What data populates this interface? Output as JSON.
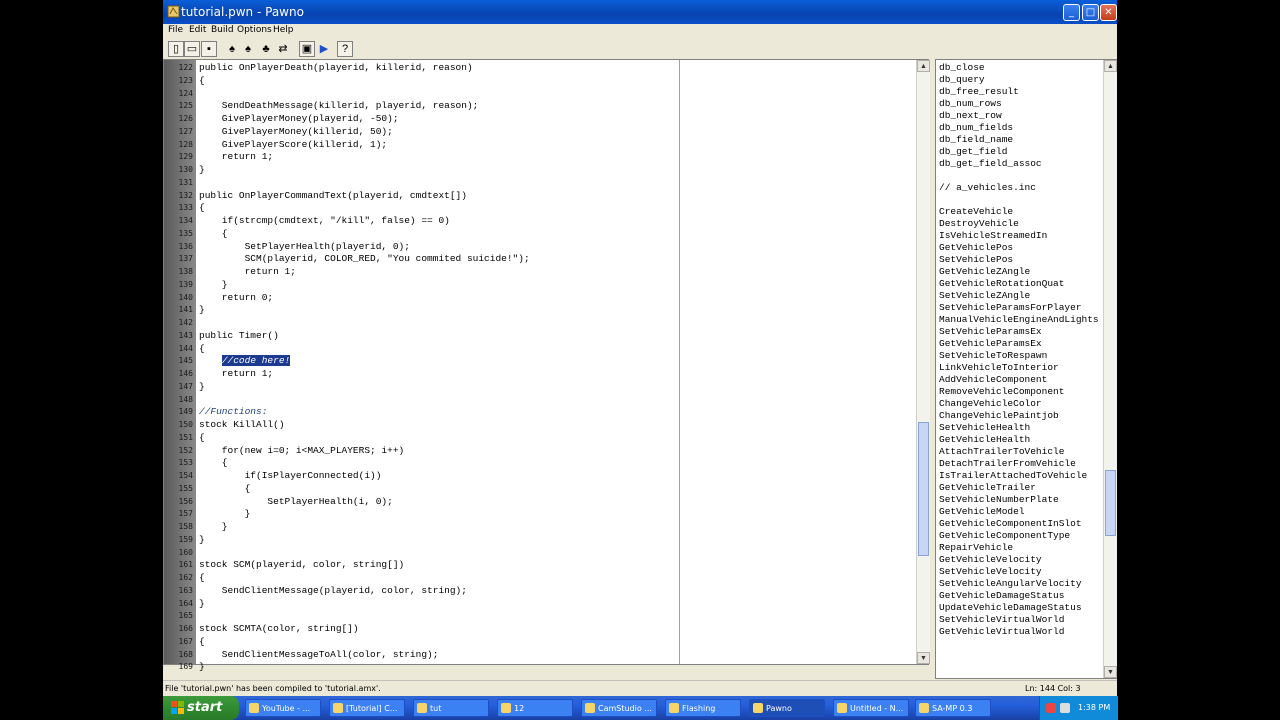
{
  "window": {
    "title": "tutorial.pwn - Pawno"
  },
  "menu": [
    "File",
    "Edit",
    "Build",
    "Options",
    "Help"
  ],
  "toolbar": [
    "new-file-icon",
    "open-folder-icon",
    "save-icon",
    "find-icon",
    "find-next-icon",
    "replace-icon",
    "goto-line-icon",
    "compile-icon",
    "run-icon",
    "help-icon"
  ],
  "editor": {
    "lines": [
      {
        "n": "122",
        "t": "public OnPlayerDeath(playerid, killerid, reason)"
      },
      {
        "n": "123",
        "t": "{"
      },
      {
        "n": "124",
        "t": ""
      },
      {
        "n": "125",
        "t": "    SendDeathMessage(killerid, playerid, reason);"
      },
      {
        "n": "126",
        "t": "    GivePlayerMoney(playerid, -50);"
      },
      {
        "n": "127",
        "t": "    GivePlayerMoney(killerid, 50);"
      },
      {
        "n": "128",
        "t": "    GivePlayerScore(killerid, 1);"
      },
      {
        "n": "129",
        "t": "    return 1;"
      },
      {
        "n": "130",
        "t": "}"
      },
      {
        "n": "131",
        "t": ""
      },
      {
        "n": "132",
        "t": "public OnPlayerCommandText(playerid, cmdtext[])"
      },
      {
        "n": "133",
        "t": "{"
      },
      {
        "n": "134",
        "t": "    if(strcmp(cmdtext, \"/kill\", false) == 0)"
      },
      {
        "n": "135",
        "t": "    {"
      },
      {
        "n": "136",
        "t": "        SetPlayerHealth(playerid, 0);"
      },
      {
        "n": "137",
        "t": "        SCM(playerid, COLOR_RED, \"You commited suicide!\");"
      },
      {
        "n": "138",
        "t": "        return 1;"
      },
      {
        "n": "139",
        "t": "    }"
      },
      {
        "n": "140",
        "t": "    return 0;"
      },
      {
        "n": "141",
        "t": "}"
      },
      {
        "n": "142",
        "t": ""
      },
      {
        "n": "143",
        "t": "public Timer()"
      },
      {
        "n": "144",
        "t": "{"
      },
      {
        "n": "145",
        "t": "    ",
        "sel": "//code here!"
      },
      {
        "n": "146",
        "t": "    return 1;"
      },
      {
        "n": "147",
        "t": "}"
      },
      {
        "n": "148",
        "t": ""
      },
      {
        "n": "149",
        "t": "//Functions:",
        "comment": true
      },
      {
        "n": "150",
        "t": "stock KillAll()"
      },
      {
        "n": "151",
        "t": "{"
      },
      {
        "n": "152",
        "t": "    for(new i=0; i<MAX_PLAYERS; i++)"
      },
      {
        "n": "153",
        "t": "    {"
      },
      {
        "n": "154",
        "t": "        if(IsPlayerConnected(i))"
      },
      {
        "n": "155",
        "t": "        {"
      },
      {
        "n": "156",
        "t": "            SetPlayerHealth(i, 0);"
      },
      {
        "n": "157",
        "t": "        }"
      },
      {
        "n": "158",
        "t": "    }"
      },
      {
        "n": "159",
        "t": "}"
      },
      {
        "n": "160",
        "t": ""
      },
      {
        "n": "161",
        "t": "stock SCM(playerid, color, string[])"
      },
      {
        "n": "162",
        "t": "{"
      },
      {
        "n": "163",
        "t": "    SendClientMessage(playerid, color, string);"
      },
      {
        "n": "164",
        "t": "}"
      },
      {
        "n": "165",
        "t": ""
      },
      {
        "n": "166",
        "t": "stock SCMTA(color, string[])"
      },
      {
        "n": "167",
        "t": "{"
      },
      {
        "n": "168",
        "t": "    SendClientMessageToAll(color, string);"
      },
      {
        "n": "169",
        "t": "}"
      }
    ]
  },
  "functions": [
    "db_close",
    "db_query",
    "db_free_result",
    "db_num_rows",
    "db_next_row",
    "db_num_fields",
    "db_field_name",
    "db_get_field",
    "db_get_field_assoc",
    "",
    " // a_vehicles.inc",
    "",
    "CreateVehicle",
    "DestroyVehicle",
    "IsVehicleStreamedIn",
    "GetVehiclePos",
    "SetVehiclePos",
    "GetVehicleZAngle",
    "GetVehicleRotationQuat",
    "SetVehicleZAngle",
    "SetVehicleParamsForPlayer",
    "ManualVehicleEngineAndLights",
    "SetVehicleParamsEx",
    "GetVehicleParamsEx",
    "SetVehicleToRespawn",
    "LinkVehicleToInterior",
    "AddVehicleComponent",
    "RemoveVehicleComponent",
    "ChangeVehicleColor",
    "ChangeVehiclePaintjob",
    "SetVehicleHealth",
    "GetVehicleHealth",
    "AttachTrailerToVehicle",
    "DetachTrailerFromVehicle",
    "IsTrailerAttachedToVehicle",
    "GetVehicleTrailer",
    "SetVehicleNumberPlate",
    "GetVehicleModel",
    "GetVehicleComponentInSlot",
    "GetVehicleComponentType",
    "RepairVehicle",
    "GetVehicleVelocity",
    "SetVehicleVelocity",
    "SetVehicleAngularVelocity",
    "GetVehicleDamageStatus",
    "UpdateVehicleDamageStatus",
    "SetVehicleVirtualWorld",
    "GetVehicleVirtualWorld"
  ],
  "status": {
    "message": "File 'tutorial.pwn' has been compiled to 'tutorial.amx'.",
    "position": "Ln: 144  Col: 3"
  },
  "taskbar": {
    "start": "start",
    "tasks": [
      "YouTube - ...",
      "[Tutorial] C...",
      "tut",
      "12",
      "CamStudio ...",
      "Flashing",
      "Pawno",
      "Untitled - N...",
      "SA-MP 0.3"
    ],
    "active": "Pawno",
    "clock": "1:38 PM"
  }
}
